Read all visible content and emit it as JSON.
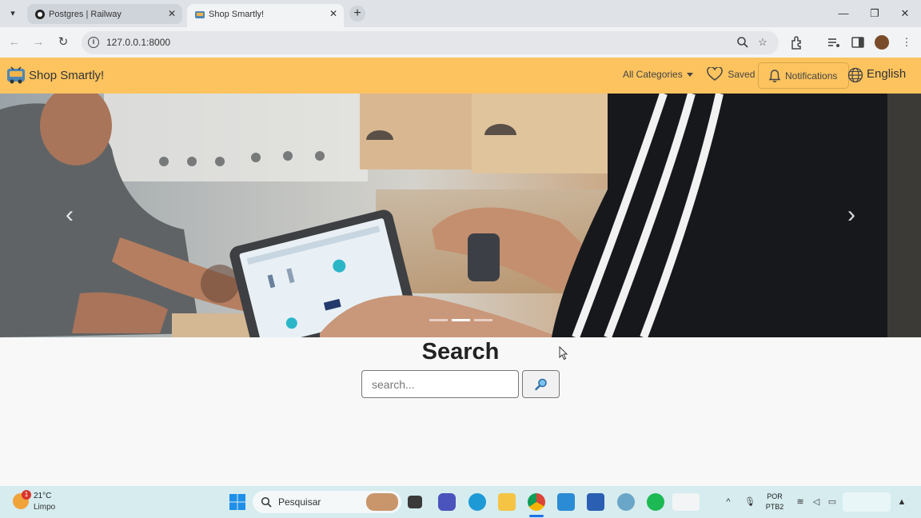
{
  "browser": {
    "tabs": [
      {
        "title": "Postgres | Railway",
        "active": false
      },
      {
        "title": "Shop Smartly!",
        "active": true
      }
    ],
    "url": "127.0.0.1:8000"
  },
  "site": {
    "brand": "Shop Smartly!",
    "nav": {
      "categories": "All Categories",
      "saved": "Saved",
      "notifications": "Notifications",
      "language": "English"
    },
    "colors": {
      "navbar": "#fcc35f"
    },
    "carousel": {
      "slide_count": 3,
      "active_index": 1
    }
  },
  "search": {
    "title": "Search",
    "placeholder": "search..."
  },
  "taskbar": {
    "weather_temp": "21°C",
    "weather_cond": "Limpo",
    "weather_badge": "1",
    "search_label": "Pesquisar",
    "lang_top": "POR",
    "lang_bottom": "PTB2"
  }
}
